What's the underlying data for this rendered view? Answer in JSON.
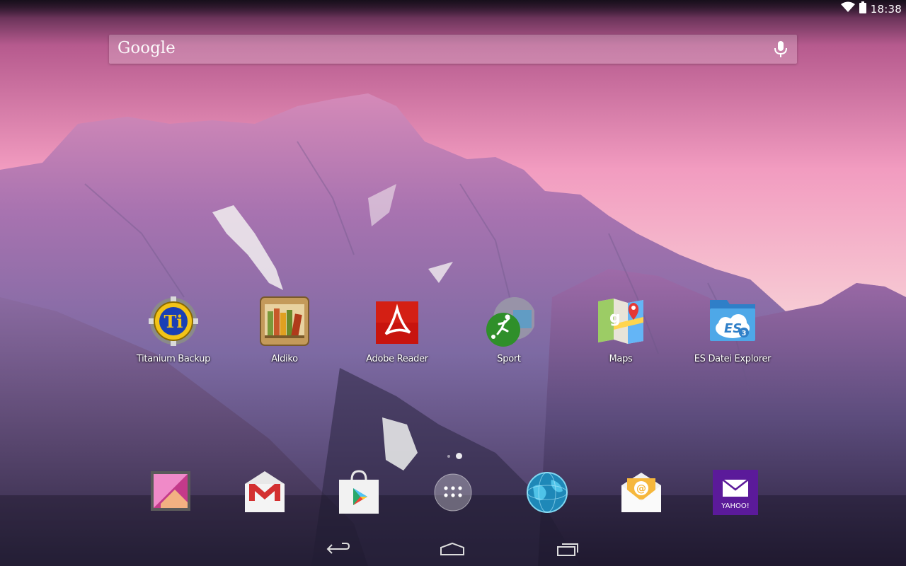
{
  "status_bar": {
    "time": "18:38",
    "icons": [
      "wifi-icon",
      "battery-icon"
    ]
  },
  "search": {
    "logo": "Google",
    "icons": [
      "mic-icon"
    ]
  },
  "apps": [
    {
      "label": "Titanium Backup",
      "icon": "titanium-backup-icon"
    },
    {
      "label": "Aldiko",
      "icon": "aldiko-icon"
    },
    {
      "label": "Adobe Reader",
      "icon": "adobe-reader-icon"
    },
    {
      "label": "Sport",
      "icon": "sport-icon"
    },
    {
      "label": "Maps",
      "icon": "maps-icon"
    },
    {
      "label": "ES Datei Explorer",
      "icon": "es-file-explorer-icon"
    }
  ],
  "page_indicator": {
    "pages": 2,
    "current": 2
  },
  "dock": [
    {
      "icon": "gallery-icon"
    },
    {
      "icon": "gmail-icon"
    },
    {
      "icon": "play-store-icon"
    },
    {
      "icon": "app-drawer-icon"
    },
    {
      "icon": "browser-globe-icon"
    },
    {
      "icon": "email-icon"
    },
    {
      "icon": "yahoo-mail-icon",
      "text": "YAHOO!"
    }
  ],
  "navigation": [
    "back-icon",
    "home-icon",
    "recents-icon"
  ],
  "colors": {
    "sky_top": "#c9609a",
    "sky_bottom": "#f8cfd8",
    "mountain_light": "#b07ab8",
    "mountain_dark": "#3d2f55"
  }
}
